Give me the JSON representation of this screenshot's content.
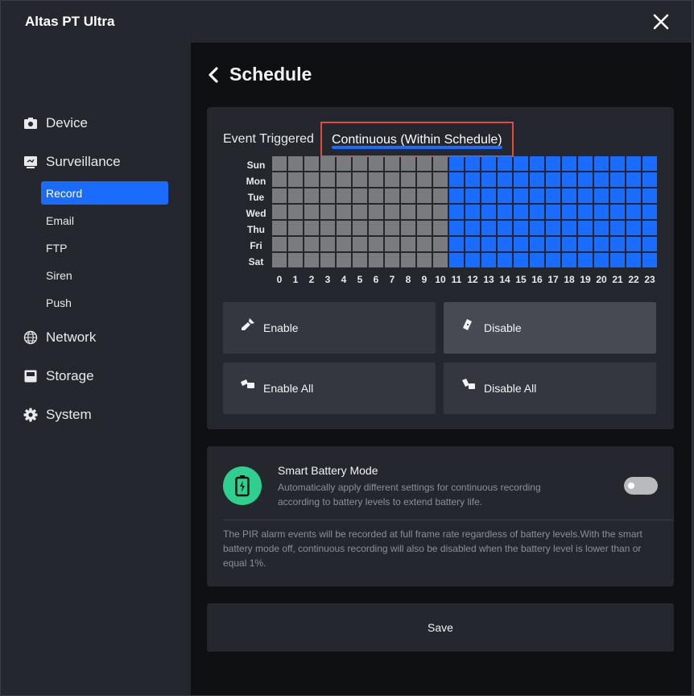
{
  "window": {
    "title": "Altas PT Ultra"
  },
  "sidebar": {
    "items": [
      {
        "label": "Device",
        "icon": "camera-icon"
      },
      {
        "label": "Surveillance",
        "icon": "surveillance-icon"
      },
      {
        "label": "Network",
        "icon": "globe-icon"
      },
      {
        "label": "Storage",
        "icon": "storage-icon"
      },
      {
        "label": "System",
        "icon": "gear-icon"
      }
    ],
    "sub_items": [
      {
        "label": "Record",
        "active": true
      },
      {
        "label": "Email",
        "active": false
      },
      {
        "label": "FTP",
        "active": false
      },
      {
        "label": "Siren",
        "active": false
      },
      {
        "label": "Push",
        "active": false
      }
    ]
  },
  "page": {
    "title": "Schedule"
  },
  "schedule": {
    "tabs": [
      {
        "label": "Event Triggered",
        "active": false
      },
      {
        "label": "Continuous (Within Schedule)",
        "active": true
      }
    ],
    "days": [
      "Sun",
      "Mon",
      "Tue",
      "Wed",
      "Thu",
      "Fri",
      "Sat"
    ],
    "hours": [
      "0",
      "1",
      "2",
      "3",
      "4",
      "5",
      "6",
      "7",
      "8",
      "9",
      "10",
      "11",
      "12",
      "13",
      "14",
      "15",
      "16",
      "17",
      "18",
      "19",
      "20",
      "21",
      "22",
      "23"
    ],
    "enabled_hours": [
      "11",
      "12",
      "13",
      "14",
      "15",
      "16",
      "17",
      "18",
      "19",
      "20",
      "21",
      "22",
      "23"
    ],
    "colors": {
      "enabled": "#1a6cff",
      "disabled": "#7a7b7e"
    },
    "buttons": {
      "enable": "Enable",
      "disable": "Disable",
      "enable_all": "Enable All",
      "disable_all": "Disable All"
    }
  },
  "smart_battery": {
    "title": "Smart Battery Mode",
    "description": "Automatically apply different settings for continuous recording according to battery levels to extend battery life.",
    "enabled": false,
    "note": "The PIR alarm events will be recorded at full frame rate regardless of battery levels.With the smart battery mode off, continuous recording will also be disabled when the battery level is lower than or equal 1%."
  },
  "save_label": "Save"
}
